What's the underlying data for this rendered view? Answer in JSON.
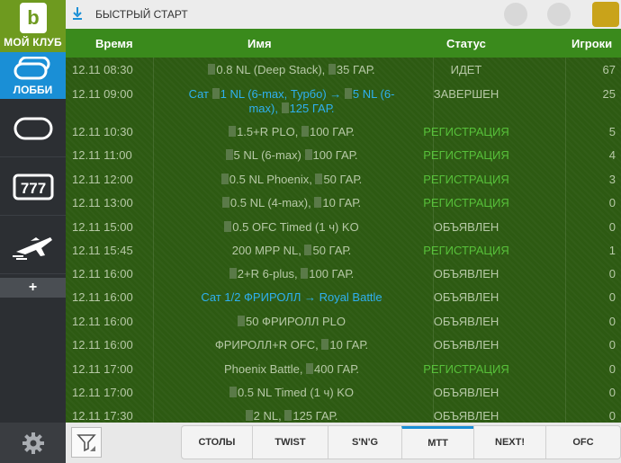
{
  "sidebar": {
    "club_label": "МОЙ КЛУБ",
    "lobby_label": "ЛОББИ",
    "plus_label": "+"
  },
  "topbar": {
    "quick_start": "БЫСТРЫЙ СТАРТ"
  },
  "table": {
    "headers": {
      "time": "Время",
      "name": "Имя",
      "status": "Статус",
      "players": "Игроки"
    },
    "rows": [
      {
        "time": "12.11 08:30",
        "name": "0.8 NL (Deep Stack), ",
        "name_tail": "35 ГАР.",
        "status": "ИДЕТ",
        "players": "67"
      },
      {
        "time": "12.11 09:00",
        "name_line1": "Сат ",
        "name_line1b": "1 NL (6-max, Турбо) → ",
        "name_line1c": "5 NL (6-",
        "name_line2": "max), ",
        "name_line2b": "125 ГАР.",
        "status": "ЗАВЕРШЕН",
        "players": "25"
      },
      {
        "time": "12.11 10:30",
        "name": "1.5+R PLO, ",
        "name_tail": "100 ГАР.",
        "status": "РЕГИСТРАЦИЯ",
        "players": "5"
      },
      {
        "time": "12.11 11:00",
        "name": "5 NL (6-max) ",
        "name_tail": "100 ГАР.",
        "status": "РЕГИСТРАЦИЯ",
        "players": "4"
      },
      {
        "time": "12.11 12:00",
        "name": "0.5 NL Phoenix, ",
        "name_tail": "50 ГАР.",
        "status": "РЕГИСТРАЦИЯ",
        "players": "3"
      },
      {
        "time": "12.11 13:00",
        "name": "0.5 NL (4-max), ",
        "name_tail": "10 ГАР.",
        "status": "РЕГИСТРАЦИЯ",
        "players": "0"
      },
      {
        "time": "12.11 15:00",
        "name": "0.5 OFC Timed (1 ч) KO",
        "name_tail": "",
        "status": "ОБЪЯВЛЕН",
        "players": "0"
      },
      {
        "time": "12.11 15:45",
        "name": "200 MPP NL, ",
        "name_tail": "50 ГАР.",
        "status": "РЕГИСТРАЦИЯ",
        "players": "1"
      },
      {
        "time": "12.11 16:00",
        "name": "2+R 6-plus, ",
        "name_tail": "100 ГАР.",
        "status": "ОБЪЯВЛЕН",
        "players": "0"
      },
      {
        "time": "12.11 16:00",
        "name": "Сат 1/2 ФРИРОЛЛ → Royal Battle",
        "name_tail": "",
        "status": "ОБЪЯВЛЕН",
        "players": "0"
      },
      {
        "time": "12.11 16:00",
        "name": "50 ФРИРОЛЛ PLO",
        "name_tail": "",
        "status": "ОБЪЯВЛЕН",
        "players": "0"
      },
      {
        "time": "12.11 16:00",
        "name": "ФРИРОЛЛ+R OFC, ",
        "name_tail": "10 ГАР.",
        "status": "ОБЪЯВЛЕН",
        "players": "0"
      },
      {
        "time": "12.11 17:00",
        "name": "Phoenix Battle, ",
        "name_tail": "400 ГАР.",
        "status": "РЕГИСТРАЦИЯ",
        "players": "0"
      },
      {
        "time": "12.11 17:00",
        "name": "0.5 NL Timed (1 ч) KO",
        "name_tail": "",
        "status": "ОБЪЯВЛЕН",
        "players": "0"
      },
      {
        "time": "12.11 17:30",
        "name": "2 NL, ",
        "name_tail": "125 ГАР.",
        "status": "ОБЪЯВЛЕН",
        "players": "0"
      }
    ]
  },
  "bottombar": {
    "tabs": [
      "СТОЛЫ",
      "TWIST",
      "S'N'G",
      "MTT",
      "NEXT!",
      "OFC"
    ],
    "active_tab": "MTT"
  },
  "colors": {
    "brand_green": "#6e9a1f",
    "accent_blue": "#1a8fd6",
    "header_green": "#3a8a1c",
    "table_bg": "#2d5a12",
    "link_blue": "#2fb0f0",
    "status_green": "#57c03a"
  },
  "icons": {
    "logo": "club-logo-icon",
    "lobby": "lobby-tables-icon",
    "table": "poker-table-icon",
    "slots": "slot-777-icon",
    "plane": "plane-icon",
    "settings": "gear-icon",
    "download": "download-icon",
    "filter": "filter-icon"
  }
}
